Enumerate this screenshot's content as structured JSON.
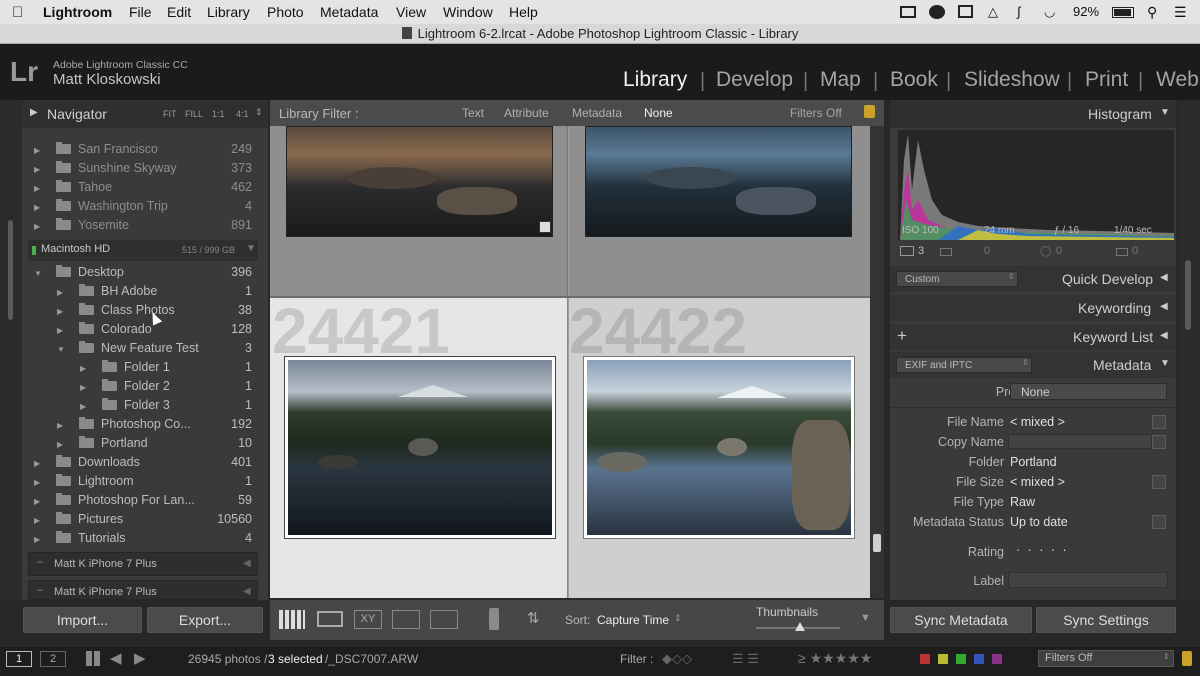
{
  "macmenu": {
    "app": "Lightroom",
    "items": [
      "File",
      "Edit",
      "Library",
      "Photo",
      "Metadata",
      "View",
      "Window",
      "Help"
    ],
    "battery": "92%"
  },
  "window_title": "Lightroom 6-2.lrcat - Adobe Photoshop Lightroom Classic - Library",
  "identity": {
    "product": "Adobe Lightroom Classic CC",
    "user": "Matt Kloskowski",
    "logo": "Lr"
  },
  "modules": [
    "Library",
    "Develop",
    "Map",
    "Book",
    "Slideshow",
    "Print",
    "Web"
  ],
  "navigator": {
    "title": "Navigator",
    "zoom": [
      "FIT",
      "FILL",
      "1:1",
      "4:1"
    ]
  },
  "folders_top": [
    {
      "name": "San Francisco",
      "count": "249"
    },
    {
      "name": "Sunshine Skyway",
      "count": "373"
    },
    {
      "name": "Tahoe",
      "count": "462"
    },
    {
      "name": "Washington Trip",
      "count": "4"
    },
    {
      "name": "Yosemite",
      "count": "891"
    }
  ],
  "volume": {
    "name": "Macintosh HD",
    "space": "515 / 999 GB"
  },
  "folders": [
    {
      "name": "Desktop",
      "count": "396"
    },
    {
      "name": "BH Adobe",
      "count": "1"
    },
    {
      "name": "Class Photos",
      "count": "38"
    },
    {
      "name": "Colorado",
      "count": "128"
    },
    {
      "name": "New Feature Test",
      "count": "3"
    },
    {
      "name": "Folder 1",
      "count": "1"
    },
    {
      "name": "Folder 2",
      "count": "1"
    },
    {
      "name": "Folder 3",
      "count": "1"
    },
    {
      "name": "Photoshop Co...",
      "count": "192"
    },
    {
      "name": "Portland",
      "count": "10"
    },
    {
      "name": "Downloads",
      "count": "401"
    },
    {
      "name": "Lightroom",
      "count": "1"
    },
    {
      "name": "Photoshop For Lan...",
      "count": "59"
    },
    {
      "name": "Pictures",
      "count": "10560"
    },
    {
      "name": "Tutorials",
      "count": "4"
    }
  ],
  "devices": [
    "Matt K iPhone 7 Plus",
    "Matt K iPhone 7 Plus"
  ],
  "left_buttons": {
    "import": "Import...",
    "export": "Export..."
  },
  "filter_bar": {
    "label": "Library Filter :",
    "options": [
      "Text",
      "Attribute",
      "Metadata",
      "None"
    ],
    "status": "Filters Off"
  },
  "grid": {
    "cell_numbers": [
      "24421",
      "24422"
    ]
  },
  "toolbar": {
    "sort_label": "Sort:",
    "sort_value": "Capture Time",
    "thumbnails_label": "Thumbnails"
  },
  "histogram": {
    "title": "Histogram",
    "iso": "ISO 100",
    "focal": "24 mm",
    "aperture": "ƒ / 16",
    "shutter": "1/40 sec",
    "count": "3",
    "zero1": "0",
    "zero2": "0",
    "zero3": "0"
  },
  "right_panels": {
    "quick_develop": "Quick Develop",
    "quick_preset": "Custom",
    "keywording": "Keywording",
    "keyword_list": "Keyword List",
    "metadata": "Metadata",
    "metadata_preset": "EXIF and IPTC"
  },
  "metadata_fields": {
    "preset_label": "Preset",
    "preset_value": "None",
    "rows": [
      {
        "label": "File Name",
        "value": "< mixed >"
      },
      {
        "label": "Copy Name",
        "value": ""
      },
      {
        "label": "Folder",
        "value": "Portland"
      },
      {
        "label": "File Size",
        "value": "< mixed >"
      },
      {
        "label": "File Type",
        "value": "Raw"
      },
      {
        "label": "Metadata Status",
        "value": "Up to date"
      }
    ],
    "rating_label": "Rating",
    "rating_value": "· · · · ·",
    "label_label": "Label"
  },
  "right_buttons": {
    "sync_metadata": "Sync Metadata",
    "sync_settings": "Sync Settings"
  },
  "filmstrip": {
    "page1": "1",
    "page2": "2",
    "status_count": "26945 photos /",
    "status_sel": "3 selected",
    "status_file": "/_DSC7007.ARW",
    "filter_label": "Filter :",
    "filter_value": "Filters Off"
  }
}
